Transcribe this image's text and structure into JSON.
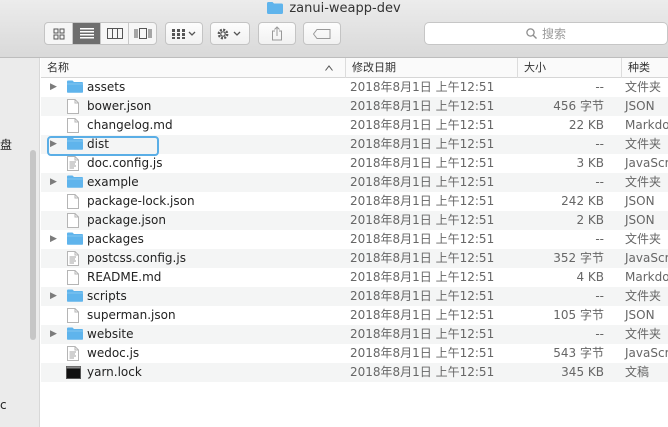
{
  "window": {
    "title": "zanui-weapp-dev"
  },
  "toolbar": {
    "search_placeholder": "搜索",
    "icons": [
      "icon-view-icon",
      "list-view-icon",
      "column-view-icon",
      "coverflow-view-icon",
      "group-icon",
      "gear-icon",
      "share-icon",
      "tag-icon"
    ]
  },
  "sidebar": {
    "items": [
      "盘",
      "c"
    ]
  },
  "columns": {
    "name": "名称",
    "date": "修改日期",
    "size": "大小",
    "kind": "种类"
  },
  "files": [
    {
      "name": "assets",
      "type": "folder",
      "date": "2018年8月1日 上午12:51",
      "size": "--",
      "kind": "文件夹"
    },
    {
      "name": "bower.json",
      "type": "file",
      "date": "2018年8月1日 上午12:51",
      "size": "456 字节",
      "kind": "JSON"
    },
    {
      "name": "changelog.md",
      "type": "file",
      "date": "2018年8月1日 上午12:51",
      "size": "22 KB",
      "kind": "Markdo"
    },
    {
      "name": "dist",
      "type": "folder",
      "date": "2018年8月1日 上午12:51",
      "size": "--",
      "kind": "文件夹"
    },
    {
      "name": "doc.config.js",
      "type": "js",
      "date": "2018年8月1日 上午12:51",
      "size": "3 KB",
      "kind": "JavaScr"
    },
    {
      "name": "example",
      "type": "folder",
      "date": "2018年8月1日 上午12:51",
      "size": "--",
      "kind": "文件夹"
    },
    {
      "name": "package-lock.json",
      "type": "file",
      "date": "2018年8月1日 上午12:51",
      "size": "242 KB",
      "kind": "JSON"
    },
    {
      "name": "package.json",
      "type": "file",
      "date": "2018年8月1日 上午12:51",
      "size": "2 KB",
      "kind": "JSON"
    },
    {
      "name": "packages",
      "type": "folder",
      "date": "2018年8月1日 上午12:51",
      "size": "--",
      "kind": "文件夹"
    },
    {
      "name": "postcss.config.js",
      "type": "js",
      "date": "2018年8月1日 上午12:51",
      "size": "352 字节",
      "kind": "JavaScr"
    },
    {
      "name": "README.md",
      "type": "file",
      "date": "2018年8月1日 上午12:51",
      "size": "4 KB",
      "kind": "Markdo"
    },
    {
      "name": "scripts",
      "type": "folder",
      "date": "2018年8月1日 上午12:51",
      "size": "--",
      "kind": "文件夹"
    },
    {
      "name": "superman.json",
      "type": "file",
      "date": "2018年8月1日 上午12:51",
      "size": "105 字节",
      "kind": "JSON"
    },
    {
      "name": "website",
      "type": "folder",
      "date": "2018年8月1日 上午12:51",
      "size": "--",
      "kind": "文件夹"
    },
    {
      "name": "wedoc.js",
      "type": "js",
      "date": "2018年8月1日 上午12:51",
      "size": "543 字节",
      "kind": "JavaScr"
    },
    {
      "name": "yarn.lock",
      "type": "exec",
      "date": "2018年8月1日 上午12:51",
      "size": "345 KB",
      "kind": "文稿"
    }
  ],
  "colors": {
    "folder": "#5fb4ec",
    "highlight": "#5aaee6",
    "active_segment": "#6e6e6e"
  }
}
